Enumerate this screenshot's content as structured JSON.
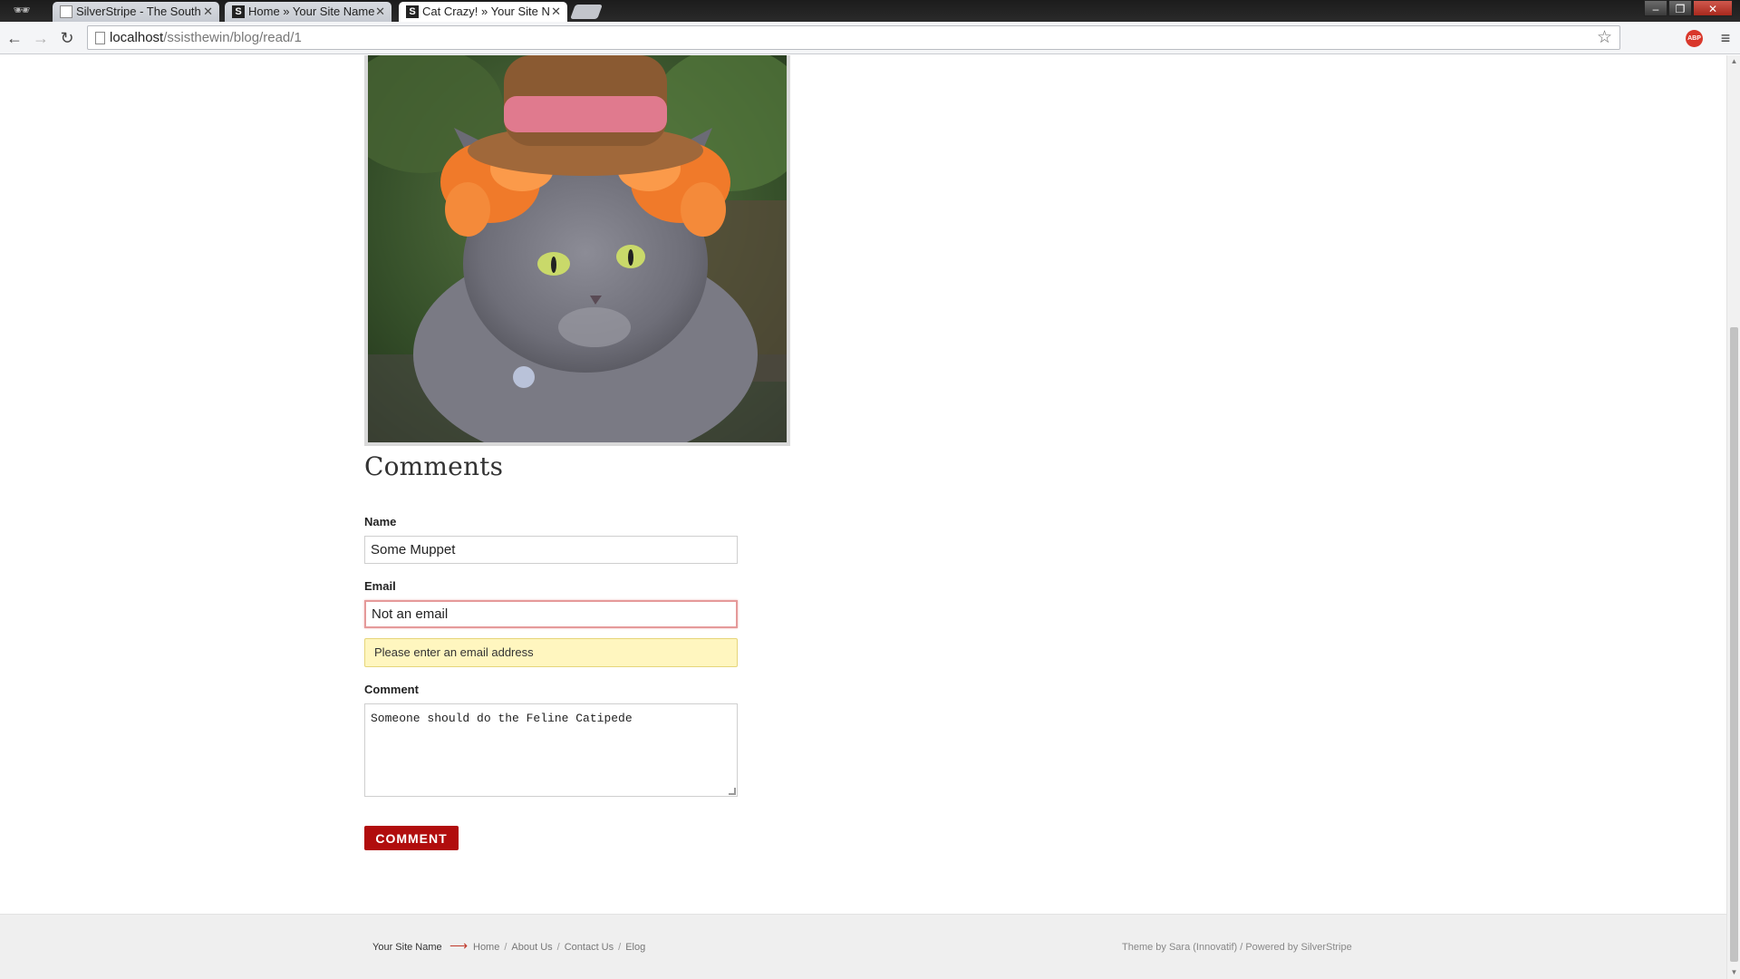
{
  "browser": {
    "tabs": [
      {
        "title": "SilverStripe - The South W",
        "favicon": "page-icon",
        "active": false
      },
      {
        "title": "Home » Your Site Name",
        "favicon": "silverstripe-icon",
        "active": false
      },
      {
        "title": "Cat Crazy! » Your Site Nan",
        "favicon": "silverstripe-icon",
        "active": true
      }
    ],
    "url_host": "localhost",
    "url_path": "/ssisthewin/blog/read/1",
    "extension_label": "ABP"
  },
  "post": {
    "image_subject": "grey cat wearing orange curly wig and straw hat"
  },
  "comments": {
    "heading": "Comments",
    "name_label": "Name",
    "name_value": "Some Muppet",
    "email_label": "Email",
    "email_value": "Not an email",
    "email_error": "Please enter an email address",
    "comment_label": "Comment",
    "comment_value": "Someone should do the Feline Catipede",
    "submit_label": "COMMENT"
  },
  "footer": {
    "site_name": "Your Site Name",
    "nav": [
      "Home",
      "About Us",
      "Contact Us",
      "Elog"
    ],
    "credits": "Theme by Sara (Innovatif) / Powered by SilverStripe"
  },
  "colors": {
    "accent": "#b10d0d",
    "error_background": "#fff6bf",
    "error_border": "#e59a9a"
  }
}
